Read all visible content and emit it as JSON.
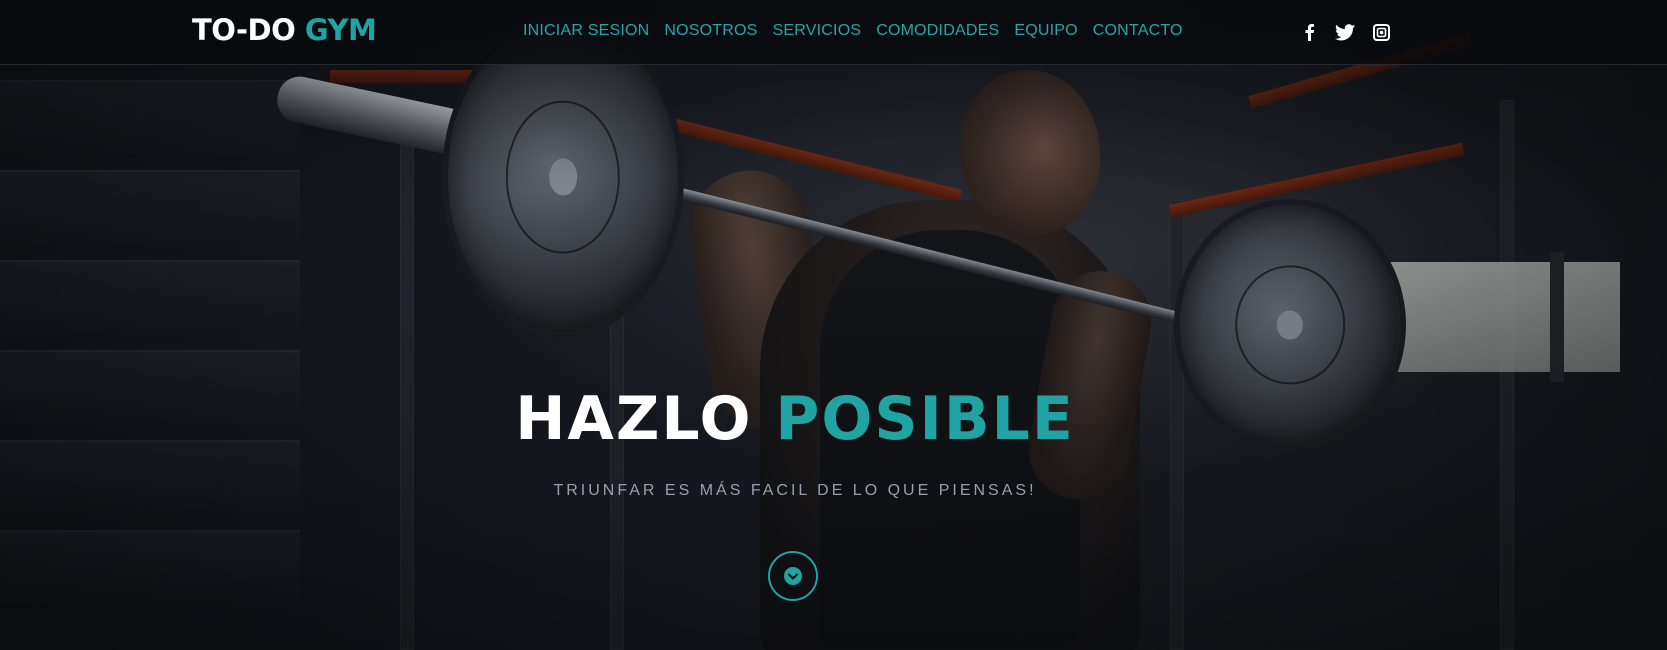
{
  "brand": {
    "name_part1": "TO-DO",
    "name_part2": "GYM"
  },
  "nav": {
    "items": [
      {
        "label": "INICIAR SESION"
      },
      {
        "label": "NOSOTROS"
      },
      {
        "label": "SERVICIOS"
      },
      {
        "label": "COMODIDADES"
      },
      {
        "label": "EQUIPO"
      },
      {
        "label": "CONTACTO"
      }
    ]
  },
  "social": {
    "icons": [
      "facebook-icon",
      "twitter-icon",
      "instagram-icon"
    ]
  },
  "hero": {
    "title_part1": "HAZLO",
    "title_part2": "POSIBLE",
    "subtitle": "TRIUNFAR ES MÁS FACIL DE LO QUE PIENSAS!"
  },
  "colors": {
    "accent": "#1fa3a3",
    "nav_link": "#24a7a7",
    "title": "#ffffff",
    "subtitle": "#9a9fae"
  }
}
